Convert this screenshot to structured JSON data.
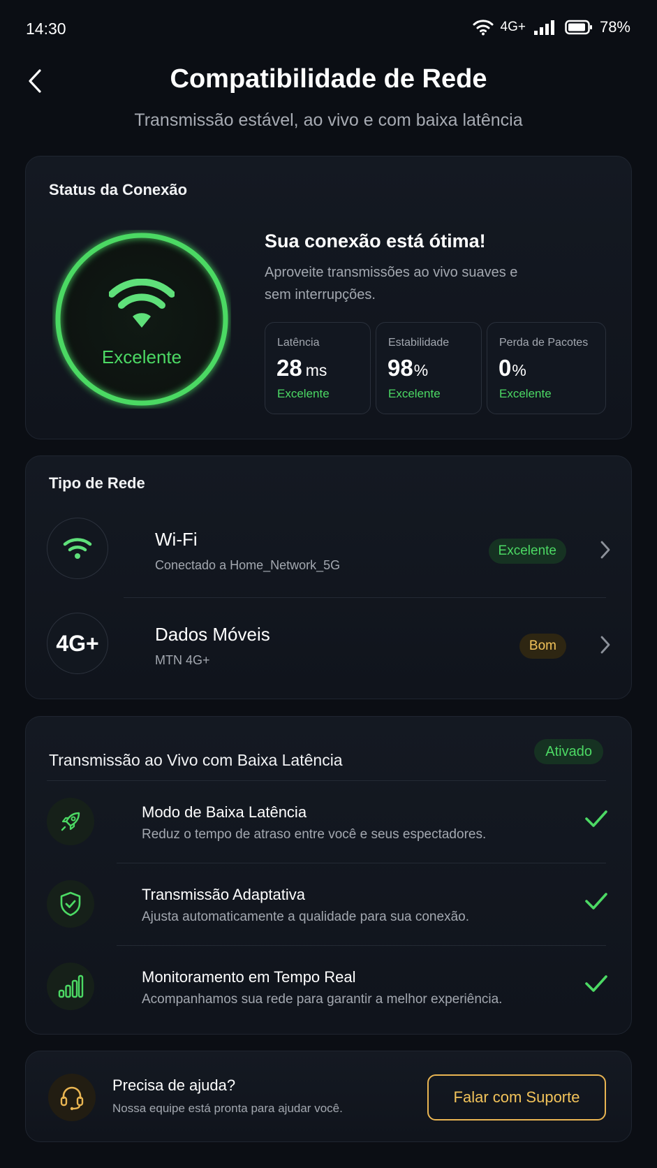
{
  "status_bar": {
    "time": "14:30",
    "network": "4G+",
    "battery": "78%"
  },
  "header": {
    "title": "Compatibilidade de Rede",
    "subtitle": "Transmissão estável, ao vivo e com baixa latência"
  },
  "connection": {
    "section_title": "Status da Conexão",
    "ring_label": "Excelente",
    "headline": "Sua conexão está ótima!",
    "description": "Aproveite transmissões ao vivo suaves e sem interrupções.",
    "metrics": [
      {
        "label": "Latência",
        "value": "28",
        "unit": "ms",
        "status": "Excelente"
      },
      {
        "label": "Estabilidade",
        "value": "98",
        "unit": "%",
        "status": "Excelente"
      },
      {
        "label": "Perda de Pacotes",
        "value": "0",
        "unit": "%",
        "status": "Excelente"
      }
    ]
  },
  "network_type": {
    "section_title": "Tipo de Rede",
    "items": [
      {
        "name": "Wi-Fi",
        "detail": "Conectado a Home_Network_5G",
        "quality": "Excelente",
        "icon": "wifi-icon"
      },
      {
        "name": "Dados Móveis",
        "detail": "MTN 4G+",
        "quality": "Bom",
        "icon_text": "4G+"
      }
    ]
  },
  "low_latency": {
    "section_title": "Transmissão ao Vivo com Baixa Latência",
    "status": "Ativado",
    "features": [
      {
        "title": "Modo de Baixa Latência",
        "description": "Reduz o tempo de atraso entre você e seus espectadores.",
        "icon": "rocket-icon"
      },
      {
        "title": "Transmissão Adaptativa",
        "description": "Ajusta automaticamente a qualidade para sua conexão.",
        "icon": "shield-check-icon"
      },
      {
        "title": "Monitoramento em Tempo Real",
        "description": "Acompanhamos sua rede para garantir a melhor experiência.",
        "icon": "signal-bars-icon"
      }
    ]
  },
  "help": {
    "title": "Precisa de ajuda?",
    "subtitle": "Nossa equipe está pronta para ajudar você.",
    "button_label": "Falar com Suporte"
  },
  "colors": {
    "background": "#0b0e14",
    "success": "#4cd964",
    "warning": "#f2c35a"
  }
}
